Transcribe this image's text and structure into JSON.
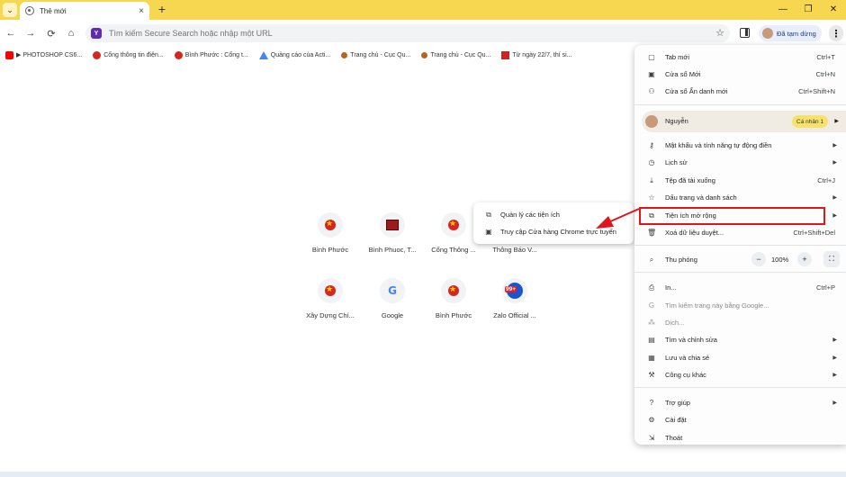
{
  "tab": {
    "title": "Thẻ mới",
    "close": "×",
    "new_tab": "+",
    "search_tabs": "⌄"
  },
  "window": {
    "minimize": "—",
    "restore": "❐",
    "close": "✕"
  },
  "toolbar": {
    "back": "←",
    "forward": "→",
    "reload": "⟳",
    "home": "⌂",
    "omnibox_placeholder": "Tìm kiếm Secure Search hoặc nhập một URL",
    "engine_badge": "Y",
    "profile_chip": "Đã tạm dừng",
    "star": "☆",
    "menu": "⋮"
  },
  "bookmarks": [
    {
      "label": "▶ PHOTOSHOP CS6...",
      "icon": "youtube-icon",
      "color": "#ff0000"
    },
    {
      "label": "Cổng thông tin điện...",
      "icon": "emblem-icon",
      "color": "#d7261e"
    },
    {
      "label": "Bình Phước : Cổng t...",
      "icon": "emblem-icon",
      "color": "#d7261e"
    },
    {
      "label": "Quảng cáo của Acti...",
      "icon": "ads-icon",
      "color": "#4285f4"
    },
    {
      "label": "Trang chủ - Cục Qu...",
      "icon": "badge-icon",
      "color": "#b5651d"
    },
    {
      "label": "Trang chủ - Cục Qu...",
      "icon": "badge-icon",
      "color": "#b5651d"
    },
    {
      "label": "Từ ngày 22/7, thí si...",
      "icon": "news-icon",
      "color": "#d21f1f"
    }
  ],
  "shortcuts": [
    {
      "label": "Bình Phước"
    },
    {
      "label": "Bình Phuoc, T..."
    },
    {
      "label": "Cổng Thông ..."
    },
    {
      "label": "Thông Báo V..."
    },
    {
      "label": "Xây Dựng Chí..."
    },
    {
      "label": "Google"
    },
    {
      "label": "Bình Phước"
    },
    {
      "label": "Zalo Official ..."
    }
  ],
  "zalo_badge": "99+",
  "google_letter": "G",
  "submenu": {
    "manage": "Quản lý các tiện ích",
    "store": "Truy cập Cửa hàng Chrome trực tuyến"
  },
  "menu": {
    "new_tab": {
      "label": "Tab mới",
      "shortcut": "Ctrl+T"
    },
    "new_window": {
      "label": "Cửa sổ Mới",
      "shortcut": "Ctrl+N"
    },
    "incognito": {
      "label": "Cửa sổ Ẩn danh mới",
      "shortcut": "Ctrl+Shift+N"
    },
    "profile": {
      "name": "Nguyễn",
      "badge": "Cá nhân 1"
    },
    "passwords": {
      "label": "Mật khẩu và tính năng tự động điền"
    },
    "history": {
      "label": "Lịch sử"
    },
    "downloads": {
      "label": "Tệp đã tải xuống",
      "shortcut": "Ctrl+J"
    },
    "bookmarks": {
      "label": "Dấu trang và danh sách"
    },
    "extensions": {
      "label": "Tiện ích mở rộng"
    },
    "clear_data": {
      "label": "Xoá dữ liệu duyệt...",
      "shortcut": "Ctrl+Shift+Del"
    },
    "zoom": {
      "label": "Thu phóng",
      "minus": "−",
      "value": "100%",
      "plus": "+",
      "fullscreen": "⛶"
    },
    "print": {
      "label": "In...",
      "shortcut": "Ctrl+P"
    },
    "google_search": {
      "label": "Tìm kiếm trang này bằng Google..."
    },
    "translate": {
      "label": "Dịch..."
    },
    "find_edit": {
      "label": "Tìm và chỉnh sửa"
    },
    "save_share": {
      "label": "Lưu và chia sẻ"
    },
    "more_tools": {
      "label": "Công cụ khác"
    },
    "help": {
      "label": "Trợ giúp"
    },
    "settings": {
      "label": "Cài đặt"
    },
    "exit": {
      "label": "Thoát"
    }
  },
  "colors": {
    "tab_strip": "#f7d650",
    "highlight": "#e0161b",
    "profile_badge": "#f7e36b"
  }
}
